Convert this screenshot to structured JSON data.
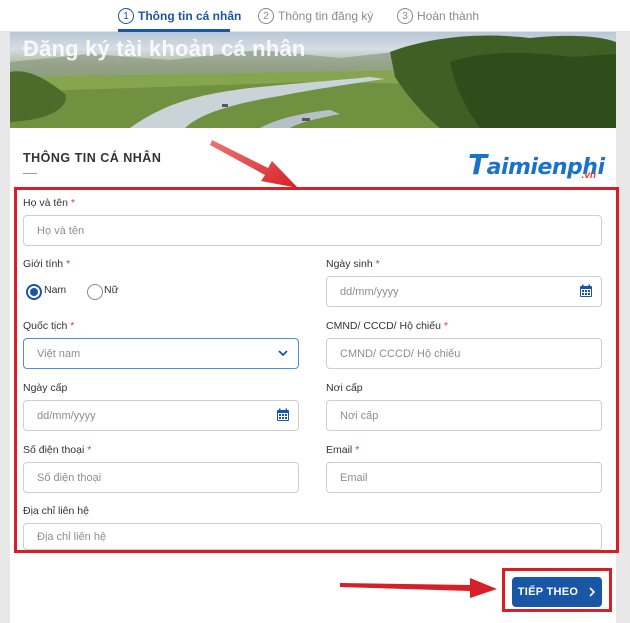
{
  "stepper": {
    "steps": [
      {
        "num": "1",
        "label": "Thông tin cá nhân"
      },
      {
        "num": "2",
        "label": "Thông tin đăng ký"
      },
      {
        "num": "3",
        "label": "Hoàn thành"
      }
    ]
  },
  "banner": {
    "title": "Đăng ký tài khoản cá nhân"
  },
  "section": {
    "title": "THÔNG TIN CÁ NHÂN"
  },
  "logo": {
    "main": "aimienphi",
    "initial": "T",
    "suffix": ".vn"
  },
  "form": {
    "fullname": {
      "label": "Họ và tên",
      "required": "*",
      "placeholder": "Họ và tên"
    },
    "gender": {
      "label": "Giới tính",
      "required": "*",
      "options": [
        "Nam",
        "Nữ"
      ],
      "selected": "Nam"
    },
    "dob": {
      "label": "Ngày sinh",
      "required": "*",
      "placeholder": "dd/mm/yyyy"
    },
    "nationality": {
      "label": "Quốc tịch",
      "required": "*",
      "value": "Việt nam"
    },
    "idnumber": {
      "label": "CMND/ CCCD/ Hộ chiếu",
      "required": "*",
      "placeholder": "CMND/ CCCD/ Hộ chiếu"
    },
    "issue_date": {
      "label": "Ngày cấp",
      "placeholder": "dd/mm/yyyy"
    },
    "issue_place": {
      "label": "Nơi cấp",
      "placeholder": "Nơi cấp"
    },
    "phone": {
      "label": "Số điện thoại",
      "required": "*",
      "placeholder": "Số điện thoại"
    },
    "email": {
      "label": "Email",
      "required": "*",
      "placeholder": "Email"
    },
    "address": {
      "label": "Địa chỉ liên hệ",
      "placeholder": "Địa chỉ liên hệ"
    }
  },
  "actions": {
    "next_label": "TIẾP THEO",
    "next_icon": "chevron-right-icon"
  },
  "colors": {
    "accent": "#1a56a6",
    "highlight": "#d52027",
    "required": "#e53935"
  }
}
